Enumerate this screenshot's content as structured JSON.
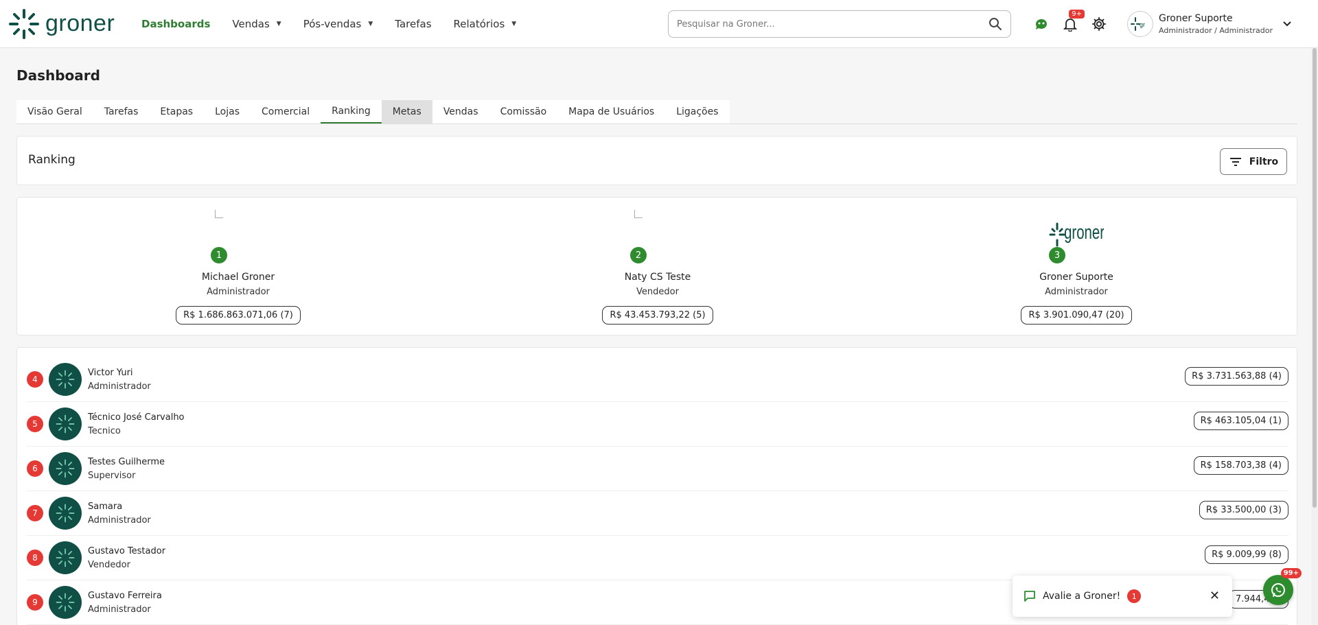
{
  "brand": {
    "logo_text": "groner",
    "color": "#0f4f46"
  },
  "nav": {
    "items": [
      {
        "label": "Dashboards",
        "active": true,
        "dropdown": false
      },
      {
        "label": "Vendas",
        "active": false,
        "dropdown": true
      },
      {
        "label": "Pós-vendas",
        "active": false,
        "dropdown": true
      },
      {
        "label": "Tarefas",
        "active": false,
        "dropdown": false
      },
      {
        "label": "Relatórios",
        "active": false,
        "dropdown": true
      }
    ]
  },
  "search": {
    "placeholder": "Pesquisar na Groner..."
  },
  "top_icons": {
    "notifications_badge": "9+",
    "icons": [
      "chat-bot-icon",
      "bell-icon",
      "gear-icon"
    ]
  },
  "user": {
    "name": "Groner Suporte",
    "role": "Administrador / Administrador"
  },
  "page": {
    "title": "Dashboard"
  },
  "tabs": [
    {
      "label": "Visão Geral"
    },
    {
      "label": "Tarefas"
    },
    {
      "label": "Etapas"
    },
    {
      "label": "Lojas"
    },
    {
      "label": "Comercial"
    },
    {
      "label": "Ranking",
      "active": true
    },
    {
      "label": "Metas",
      "hover": true
    },
    {
      "label": "Vendas"
    },
    {
      "label": "Comissão"
    },
    {
      "label": "Mapa de Usuários"
    },
    {
      "label": "Ligações"
    }
  ],
  "ranking": {
    "title": "Ranking",
    "filter_label": "Filtro",
    "podium": [
      {
        "pos": "1",
        "name": "Michael Groner",
        "role": "Administrador",
        "value": "R$ 1.686.863.071,06 (7)",
        "image": "broken"
      },
      {
        "pos": "2",
        "name": "Naty CS Teste",
        "role": "Vendedor",
        "value": "R$ 43.453.793,22 (5)",
        "image": "broken"
      },
      {
        "pos": "3",
        "name": "Groner Suporte",
        "role": "Administrador",
        "value": "R$ 3.901.090,47 (20)",
        "image": "groner-logo"
      }
    ],
    "list": [
      {
        "pos": "4",
        "name": "Victor Yuri",
        "role": "Administrador",
        "value": "R$ 3.731.563,88 (4)"
      },
      {
        "pos": "5",
        "name": "Técnico José Carvalho",
        "role": "Tecnico",
        "value": "R$ 463.105,04 (1)"
      },
      {
        "pos": "6",
        "name": "Testes Guilherme",
        "role": "Supervisor",
        "value": "R$ 158.703,38 (4)"
      },
      {
        "pos": "7",
        "name": "Samara",
        "role": "Administrador",
        "value": "R$ 33.500,00 (3)"
      },
      {
        "pos": "8",
        "name": "Gustavo Testador",
        "role": "Vendedor",
        "value": "R$ 9.009,99 (8)"
      },
      {
        "pos": "9",
        "name": "Gustavo Ferreira",
        "role": "Administrador",
        "value": "7.944,44 ("
      }
    ]
  },
  "toast": {
    "text": "Avalie a Groner!",
    "badge": "1"
  },
  "whatsapp": {
    "badge": "99+"
  },
  "colors": {
    "accent_green": "#2e7d32",
    "rank_badge_top": "#2e8b2e",
    "rank_badge_rest": "#e53935"
  }
}
